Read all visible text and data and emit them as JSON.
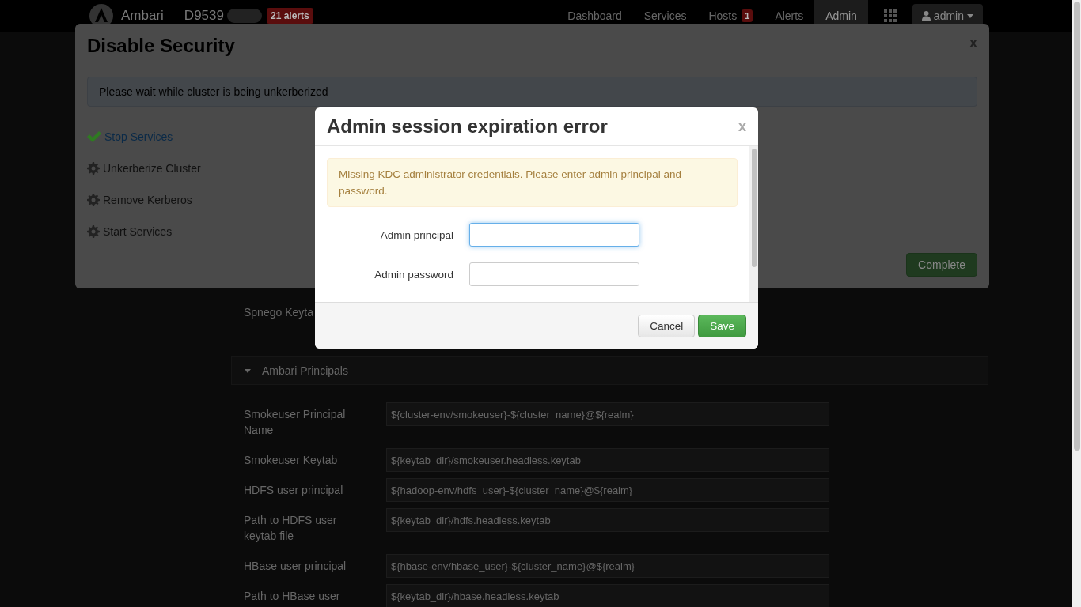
{
  "navbar": {
    "brand": "Ambari",
    "cluster": "D9539",
    "alerts_badge": "21 alerts",
    "items": [
      {
        "label": "Dashboard",
        "selected": false
      },
      {
        "label": "Services",
        "selected": false
      },
      {
        "label": "Hosts",
        "badge": "1",
        "selected": false
      },
      {
        "label": "Alerts",
        "selected": false
      },
      {
        "label": "Admin",
        "selected": true
      }
    ],
    "user": "admin"
  },
  "page": {
    "top_rows": [
      {
        "label": "Spnego Keyta"
      }
    ],
    "section": {
      "title": "Ambari Principals",
      "expanded": true
    },
    "rows": [
      {
        "label": "Smokeuser Principal Name",
        "value": "${cluster-env/smokeuser}-${cluster_name}@${realm}"
      },
      {
        "label": "Smokeuser Keytab",
        "value": "${keytab_dir}/smokeuser.headless.keytab"
      },
      {
        "label": "HDFS user principal",
        "value": "${hadoop-env/hdfs_user}-${cluster_name}@${realm}"
      },
      {
        "label": "Path to HDFS user keytab file",
        "value": "${keytab_dir}/hdfs.headless.keytab"
      },
      {
        "label": "HBase user principal",
        "value": "${hbase-env/hbase_user}-${cluster_name}@${realm}"
      },
      {
        "label": "Path to HBase user",
        "value": "${keytab_dir}/hbase.headless.keytab"
      }
    ]
  },
  "wizard": {
    "title": "Disable Security",
    "close": "x",
    "message": "Please wait while cluster is being unkerberized",
    "steps": [
      {
        "label": "Stop Services",
        "done": true
      },
      {
        "label": "Unkerberize Cluster",
        "done": false
      },
      {
        "label": "Remove Kerberos",
        "done": false
      },
      {
        "label": "Start Services",
        "done": false
      }
    ],
    "complete_button": {
      "label": "Complete",
      "disabled": true
    }
  },
  "dialog": {
    "title": "Admin session expiration error",
    "close": "x",
    "warning": "Missing KDC administrator credentials. Please enter admin principal and password.",
    "fields": [
      {
        "label": "Admin principal",
        "focused": true
      },
      {
        "label": "Admin password",
        "focused": false
      }
    ],
    "buttons": [
      {
        "label": "Cancel",
        "kind": "default"
      },
      {
        "label": "Save",
        "kind": "primary"
      }
    ]
  }
}
